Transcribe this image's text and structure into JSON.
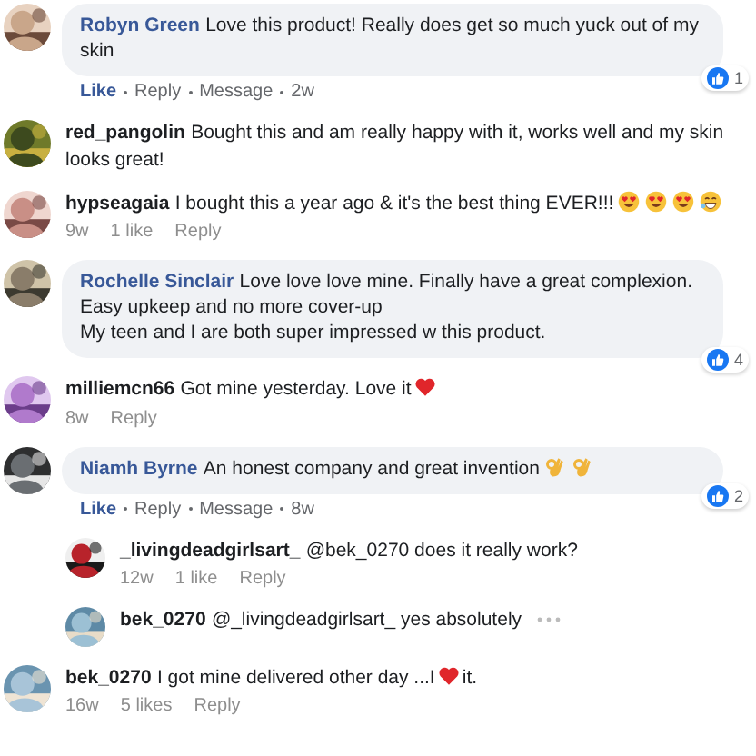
{
  "comments": [
    {
      "kind": "facebook",
      "author": "Robyn Green",
      "body": [
        {
          "kind": "text",
          "text": "Love this product! Really does get so much yuck out of my skin"
        }
      ],
      "reaction_count": "1",
      "meta": [
        {
          "text": "Like",
          "selected": true
        },
        {
          "text": "Reply",
          "selected": false
        },
        {
          "text": "Message",
          "selected": false
        },
        {
          "text": "2w",
          "selected": false
        }
      ]
    },
    {
      "kind": "instagram",
      "author": "red_pangolin",
      "body": [
        {
          "kind": "text",
          "text": "Bought this and am really happy with it, works well and my skin looks great!"
        }
      ]
    },
    {
      "kind": "instagram",
      "author": "hypseagaia",
      "body": [
        {
          "kind": "text",
          "text": "I bought this a year ago & it's the best thing EVER!!!"
        },
        {
          "kind": "heart_eyes"
        },
        {
          "kind": "heart_eyes"
        },
        {
          "kind": "heart_eyes"
        },
        {
          "kind": "grin_sweat"
        }
      ],
      "meta": [
        {
          "text": "9w",
          "selected": false
        },
        {
          "text": "1 like",
          "selected": false
        },
        {
          "text": "Reply",
          "selected": false
        }
      ]
    },
    {
      "kind": "facebook",
      "author": "Rochelle Sinclair",
      "body": [
        {
          "kind": "text",
          "text": "Love love love mine. Finally have a great complexion. Easy upkeep and no more cover-up"
        },
        {
          "kind": "break"
        },
        {
          "kind": "text",
          "text": "My teen and I are both super impressed w this product."
        }
      ],
      "reaction_count": "4"
    },
    {
      "kind": "instagram",
      "author": "milliemcn66",
      "body": [
        {
          "kind": "text",
          "text": "Got mine yesterday. Love it"
        },
        {
          "kind": "heart"
        }
      ],
      "meta": [
        {
          "text": "8w",
          "selected": false
        },
        {
          "text": "Reply",
          "selected": false
        }
      ]
    },
    {
      "kind": "facebook",
      "author": "Niamh Byrne",
      "body": [
        {
          "kind": "text",
          "text": "An honest company and great invention"
        },
        {
          "kind": "ok_hand"
        },
        {
          "kind": "ok_hand"
        }
      ],
      "reaction_count": "2",
      "meta": [
        {
          "text": "Like",
          "selected": true
        },
        {
          "text": "Reply",
          "selected": false
        },
        {
          "text": "Message",
          "selected": false
        },
        {
          "text": "8w",
          "selected": false
        }
      ]
    },
    {
      "kind": "instagram-reply",
      "author": "_livingdeadgirlsart_",
      "body": [
        {
          "kind": "text",
          "text": "@bek_0270 does it really work?"
        }
      ],
      "meta": [
        {
          "text": "12w",
          "selected": false
        },
        {
          "text": "1 like",
          "selected": false
        },
        {
          "text": "Reply",
          "selected": false
        }
      ]
    },
    {
      "kind": "instagram-reply",
      "author": "bek_0270",
      "body": [
        {
          "kind": "text",
          "text": "@_livingdeadgirlsart_ yes absolutely"
        }
      ],
      "more": true
    },
    {
      "kind": "instagram",
      "author": "bek_0270",
      "body": [
        {
          "kind": "text",
          "text": "I got mine delivered other day ...I"
        },
        {
          "kind": "heart"
        },
        {
          "kind": "text",
          "text": "it."
        }
      ],
      "meta": [
        {
          "text": "16w",
          "selected": false
        },
        {
          "text": "5 likes",
          "selected": false
        },
        {
          "text": "Reply",
          "selected": false
        }
      ]
    }
  ]
}
